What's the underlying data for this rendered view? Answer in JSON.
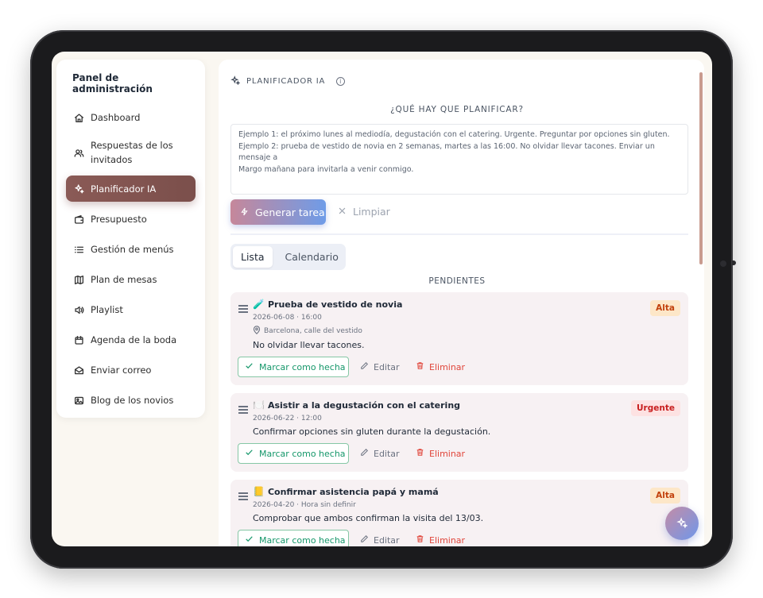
{
  "sidebar": {
    "title": "Panel de administración",
    "items": [
      {
        "label": "Dashboard",
        "icon": "home-icon"
      },
      {
        "label_line1": "Respuestas de los",
        "label_line2": "invitados",
        "icon": "users-icon"
      },
      {
        "label": "Planificador IA",
        "icon": "sparkles-icon",
        "active": true
      },
      {
        "label": "Presupuesto",
        "icon": "wallet-icon"
      },
      {
        "label": "Gestión de menús",
        "icon": "list-icon"
      },
      {
        "label": "Plan de mesas",
        "icon": "map-icon"
      },
      {
        "label": "Playlist",
        "icon": "speaker-icon"
      },
      {
        "label": "Agenda de la boda",
        "icon": "calendar-icon"
      },
      {
        "label": "Enviar correo",
        "icon": "mail-icon"
      },
      {
        "label": "Blog de los novios",
        "icon": "image-icon"
      }
    ]
  },
  "planner": {
    "header": "PLANIFICADOR IA",
    "question": "¿QUÉ HAY QUE PLANIFICAR?",
    "placeholder_line1": "Ejemplo 1: el próximo lunes al mediodía, degustación con el catering. Urgente. Preguntar por opciones sin gluten.",
    "placeholder_line2": "Ejemplo 2: prueba de vestido de novia en 2 semanas, martes a las 16:00. No olvidar llevar tacones. Enviar un mensaje a",
    "placeholder_line3": "Margo mañana para invitarla a venir conmigo.",
    "generate_label": "Generar tarea",
    "clear_label": "Limpiar"
  },
  "tabs": [
    {
      "label": "Lista",
      "active": true
    },
    {
      "label": "Calendario",
      "active": false
    }
  ],
  "section_label": "PENDIENTES",
  "tasks": [
    {
      "emoji": "🧪",
      "title": "Prueba de vestido de novia",
      "meta": "2026-06-08 · 16:00",
      "location": "Barcelona, calle del vestido",
      "description": "No olvidar llevar tacones.",
      "priority": "Alta"
    },
    {
      "emoji": "🍽️",
      "title": "Asistir a la degustación con el catering",
      "meta": "2026-06-22 · 12:00",
      "description": "Confirmar opciones sin gluten durante la degustación.",
      "priority": "Urgente"
    },
    {
      "emoji": "📒",
      "title": "Confirmar asistencia papá y mamá",
      "meta": "2026-04-20 · Hora sin definir",
      "description": "Comprobar que ambos confirman la visita del 13/03.",
      "priority": "Alta"
    }
  ],
  "actions": {
    "done_label": "Marcar como hecha",
    "edit_label": "Editar",
    "delete_label": "Eliminar"
  },
  "colors": {
    "active_nav": "#7b4f4b",
    "done_green": "#15976a",
    "delete_red": "#e0453a",
    "gradient_start": "#c6879a",
    "gradient_end": "#6f9ce8"
  }
}
